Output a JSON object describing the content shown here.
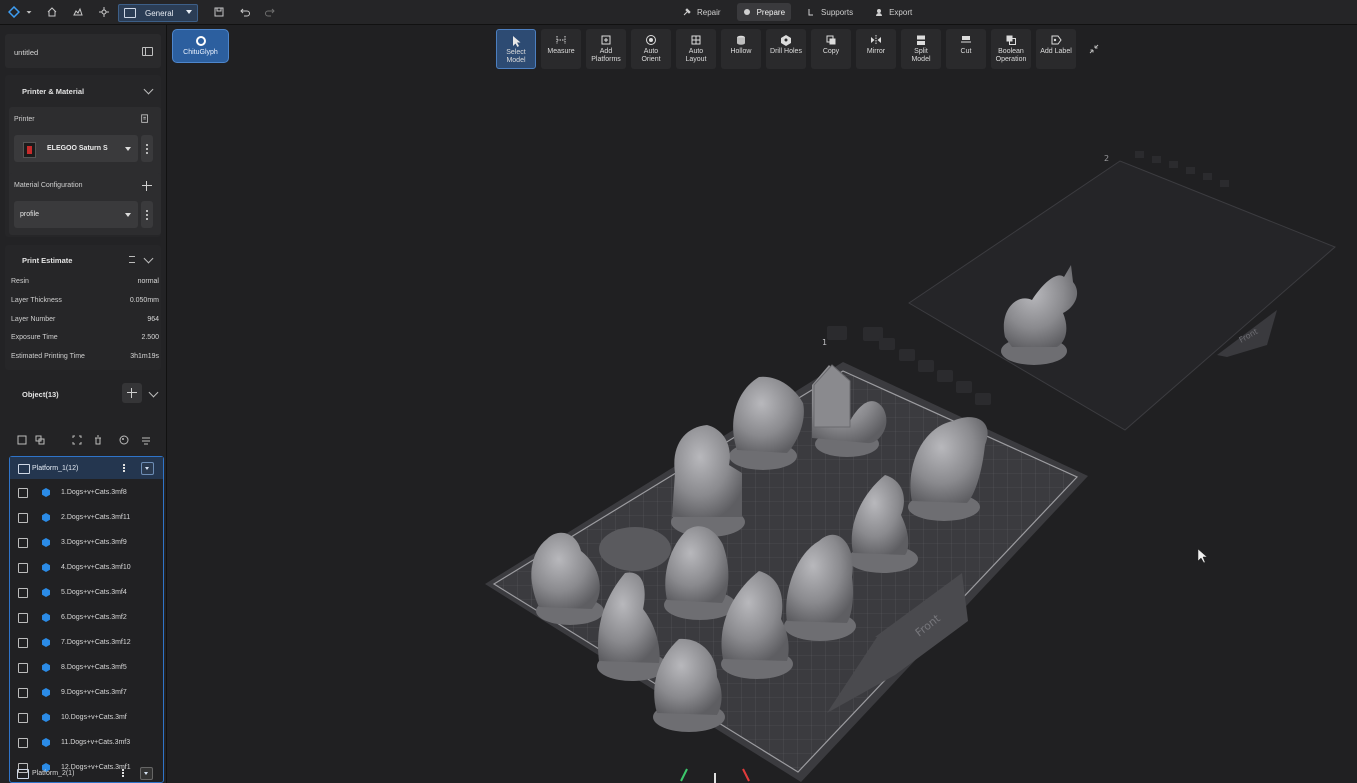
{
  "topbar": {
    "workspace_label": "General",
    "modes": [
      {
        "label": "Repair",
        "icon": "repair-icon",
        "active": false
      },
      {
        "label": "Prepare",
        "icon": "prepare-icon",
        "active": true
      },
      {
        "label": "Supports",
        "icon": "supports-icon",
        "active": false
      },
      {
        "label": "Export",
        "icon": "export-icon",
        "active": false
      }
    ]
  },
  "sidebar": {
    "project_name": "untitled",
    "printer_material": {
      "title": "Printer & Material",
      "printer_label": "Printer",
      "printer_value": "ELEGOO Saturn S",
      "material_label": "Material Configuration",
      "material_value": "profile"
    },
    "print_estimate": {
      "title": "Print Estimate",
      "rows": [
        {
          "label": "Resin",
          "value": "normal"
        },
        {
          "label": "Layer Thickness",
          "value": "0.050mm"
        },
        {
          "label": "Layer Number",
          "value": "964"
        },
        {
          "label": "Exposure Time",
          "value": "2.500"
        },
        {
          "label": "Estimated Printing Time",
          "value": "3h1m19s"
        }
      ]
    },
    "objects": {
      "title": "Object(13)",
      "platform1_label": "Platform_1(12)",
      "items": [
        "1.Dogs+v+Cats.3mf8",
        "2.Dogs+v+Cats.3mf11",
        "3.Dogs+v+Cats.3mf9",
        "4.Dogs+v+Cats.3mf10",
        "5.Dogs+v+Cats.3mf4",
        "6.Dogs+v+Cats.3mf2",
        "7.Dogs+v+Cats.3mf12",
        "8.Dogs+v+Cats.3mf5",
        "9.Dogs+v+Cats.3mf7",
        "10.Dogs+v+Cats.3mf",
        "11.Dogs+v+Cats.3mf3",
        "12.Dogs+v+Cats.3mf1"
      ],
      "platform2_label": "Platform_2(1)"
    }
  },
  "viewport": {
    "chitu_label": "ChituGlyph",
    "tools": [
      {
        "label": "Select\nModel",
        "icon": "cursor-icon",
        "active": true
      },
      {
        "label": "Measure",
        "icon": "measure-icon",
        "active": false
      },
      {
        "label": "Add\nPlatforms",
        "icon": "add-platform-icon",
        "active": false
      },
      {
        "label": "Auto\nOrient",
        "icon": "auto-orient-icon",
        "active": false
      },
      {
        "label": "Auto\nLayout",
        "icon": "auto-layout-icon",
        "active": false
      },
      {
        "label": "Hollow",
        "icon": "hollow-icon",
        "active": false
      },
      {
        "label": "Drill Holes",
        "icon": "drill-icon",
        "active": false
      },
      {
        "label": "Copy",
        "icon": "copy-icon",
        "active": false
      },
      {
        "label": "Mirror",
        "icon": "mirror-icon",
        "active": false
      },
      {
        "label": "Split\nModel",
        "icon": "split-icon",
        "active": false
      },
      {
        "label": "Cut",
        "icon": "cut-icon",
        "active": false
      },
      {
        "label": "Boolean\nOperation",
        "icon": "boolean-icon",
        "active": false
      },
      {
        "label": "Add Label",
        "icon": "label-icon",
        "active": false
      }
    ],
    "platform_front_label": "Front",
    "platform2_front_label": "Front",
    "platform_number": "1",
    "platform2_number": "2"
  },
  "colors": {
    "accent": "#2f74c9",
    "panel": "#232325",
    "background": "#202022",
    "model": "#8e8e92",
    "object_icon": "#2b8be6"
  }
}
